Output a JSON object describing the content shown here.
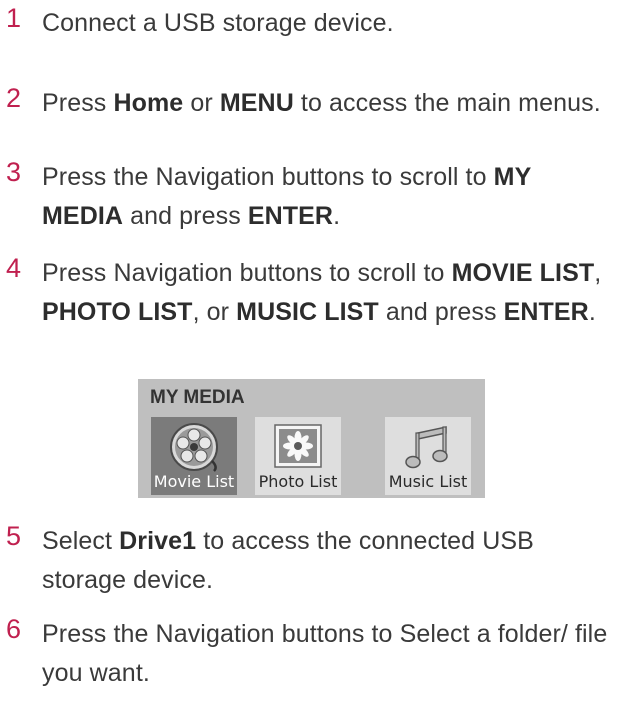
{
  "steps": [
    {
      "num": "1",
      "parts": [
        {
          "t": "Connect a USB storage device.",
          "b": false
        }
      ]
    },
    {
      "num": "2",
      "parts": [
        {
          "t": "Press ",
          "b": false
        },
        {
          "t": "Home",
          "b": true
        },
        {
          "t": " or ",
          "b": false
        },
        {
          "t": "MENU",
          "b": true
        },
        {
          "t": " to access the main menus.",
          "b": false
        }
      ]
    },
    {
      "num": "3",
      "parts": [
        {
          "t": "Press the Navigation buttons to scroll to ",
          "b": false
        },
        {
          "t": "MY MEDIA",
          "b": true
        },
        {
          "t": " and press ",
          "b": false
        },
        {
          "t": "ENTER",
          "b": true
        },
        {
          "t": ".",
          "b": false
        }
      ]
    },
    {
      "num": "4",
      "parts": [
        {
          "t": "Press Navigation buttons to scroll to ",
          "b": false
        },
        {
          "t": "MOVIE LIST",
          "b": true
        },
        {
          "t": ", ",
          "b": false
        },
        {
          "t": "PHOTO LIST",
          "b": true
        },
        {
          "t": ", or ",
          "b": false
        },
        {
          "t": "MUSIC LIST",
          "b": true
        },
        {
          "t": " and press ",
          "b": false
        },
        {
          "t": "ENTER",
          "b": true
        },
        {
          "t": ".",
          "b": false
        }
      ]
    },
    {
      "num": "5",
      "parts": [
        {
          "t": "Select ",
          "b": false
        },
        {
          "t": "Drive1",
          "b": true
        },
        {
          "t": " to access the connected USB storage device.",
          "b": false
        }
      ]
    },
    {
      "num": "6",
      "parts": [
        {
          "t": "Press the Navigation buttons to Select a folder/ file you want.",
          "b": false
        }
      ]
    }
  ],
  "media_panel": {
    "title": "MY MEDIA",
    "items": [
      {
        "label": "Movie List",
        "icon": "film-reel-icon",
        "selected": true
      },
      {
        "label": "Photo List",
        "icon": "flower-photo-icon",
        "selected": false
      },
      {
        "label": "Music List",
        "icon": "music-note-icon",
        "selected": false
      }
    ]
  },
  "colors": {
    "step_number": "#c0204f",
    "panel_bg": "#bfbfbf",
    "selected_bg": "#7b7b7b"
  }
}
